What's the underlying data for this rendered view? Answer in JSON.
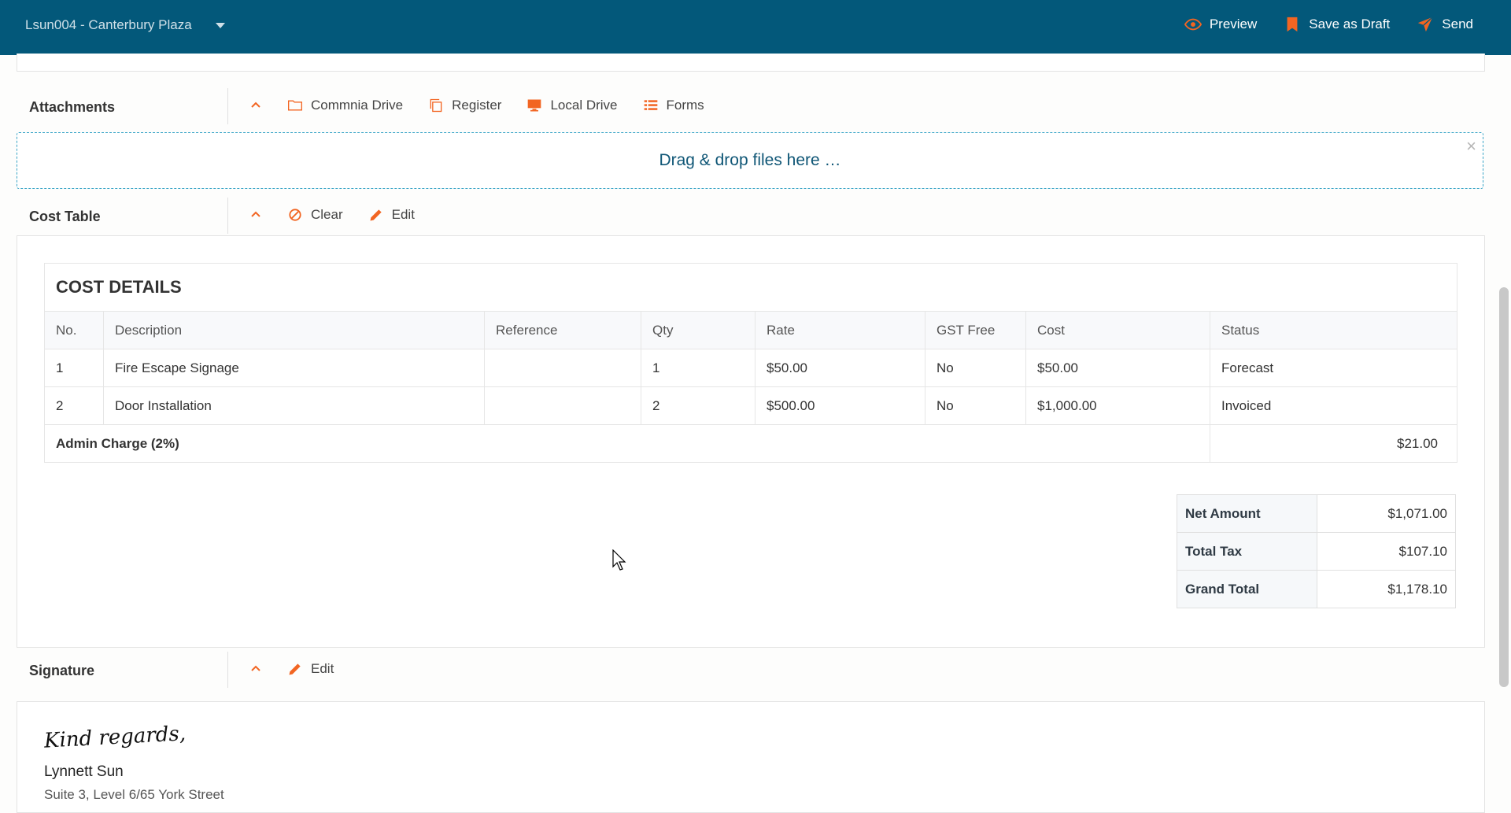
{
  "header": {
    "project": "Lsun004 - Canterbury Plaza",
    "actions": {
      "preview": "Preview",
      "draft": "Save as Draft",
      "send": "Send"
    }
  },
  "attachments": {
    "title": "Attachments",
    "tools": {
      "commnia": "Commnia Drive",
      "register": "Register",
      "local": "Local Drive",
      "forms": "Forms"
    },
    "dropzone": "Drag & drop files here …"
  },
  "cost_section": {
    "title": "Cost Table",
    "tools": {
      "clear": "Clear",
      "edit": "Edit"
    },
    "table_title": "COST DETAILS",
    "columns": [
      "No.",
      "Description",
      "Reference",
      "Qty",
      "Rate",
      "GST Free",
      "Cost",
      "Status"
    ],
    "rows": [
      [
        "1",
        "Fire Escape Signage",
        "",
        "1",
        "$50.00",
        "No",
        "$50.00",
        "Forecast"
      ],
      [
        "2",
        "Door Installation",
        "",
        "2",
        "$500.00",
        "No",
        "$1,000.00",
        "Invoiced"
      ]
    ],
    "admin_label": "Admin Charge (2%)",
    "admin_amount": "$21.00",
    "totals": {
      "net_label": "Net Amount",
      "net_value": "$1,071.00",
      "tax_label": "Total Tax",
      "tax_value": "$107.10",
      "grand_label": "Grand Total",
      "grand_value": "$1,178.10"
    }
  },
  "signature": {
    "title": "Signature",
    "edit": "Edit",
    "script": "Kind regards,",
    "name": "Lynnett Sun",
    "address": "Suite 3, Level 6/65 York Street"
  },
  "colors": {
    "brand_bar": "#03587a",
    "accent": "#f26522"
  }
}
